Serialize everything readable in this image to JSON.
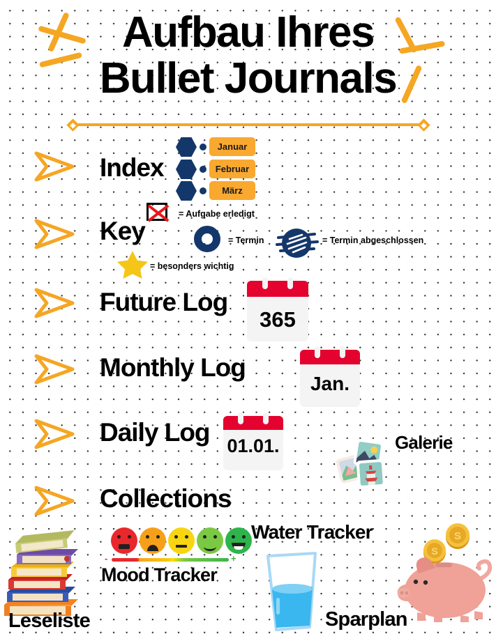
{
  "title": {
    "line1": "Aufbau Ihres",
    "line2": "Bullet Journals"
  },
  "colors": {
    "accent_orange": "#f5a623",
    "badge_orange": "#f9a830",
    "navy": "#14376b",
    "calendar_red": "#e4032e",
    "star_yellow": "#f5c518",
    "cross_red": "#e8181b"
  },
  "sections": [
    {
      "label": "Index"
    },
    {
      "label": "Key"
    },
    {
      "label": "Future Log"
    },
    {
      "label": "Monthly Log"
    },
    {
      "label": "Daily Log"
    },
    {
      "label": "Collections"
    }
  ],
  "index": {
    "months": [
      "Januar",
      "Februar",
      "März"
    ]
  },
  "key": {
    "entries": [
      {
        "icon": "crossed-box-icon",
        "text": "= Aufgabe erledigt"
      },
      {
        "icon": "ring-icon",
        "text": "= Termin"
      },
      {
        "icon": "scribbled-circle-icon",
        "text": "= Termin abgeschlossen"
      },
      {
        "icon": "star-icon",
        "text": "= besonders wichtig"
      }
    ]
  },
  "calendars": {
    "future_log": "365",
    "monthly_log": "Jan.",
    "daily_log": "01.01."
  },
  "collections": {
    "items": [
      {
        "label": "Galerie",
        "icon": "photo-stack-icon"
      },
      {
        "label": "Mood Tracker",
        "icon": "emoji-scale-icon"
      },
      {
        "label": "Water Tracker",
        "icon": "water-glass-icon"
      },
      {
        "label": "Leseliste",
        "icon": "book-stack-icon"
      },
      {
        "label": "Sparplan",
        "icon": "piggy-bank-icon"
      }
    ]
  },
  "mood_tracker": {
    "faces": [
      {
        "name": "angry",
        "color": "#e8282a"
      },
      {
        "name": "sad",
        "color": "#f6a01a"
      },
      {
        "name": "neutral",
        "color": "#f7d511"
      },
      {
        "name": "smile",
        "color": "#7ac943"
      },
      {
        "name": "happy",
        "color": "#2eb44a"
      }
    ],
    "scale_min": "-",
    "scale_max": "+"
  }
}
